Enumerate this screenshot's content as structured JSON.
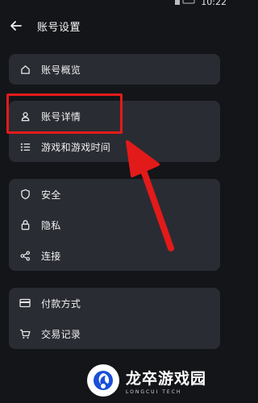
{
  "status_bar": {
    "time": "10:22"
  },
  "header": {
    "title": "账号设置"
  },
  "groups": [
    {
      "items": [
        {
          "label": "账号概览",
          "icon": "home-icon"
        }
      ]
    },
    {
      "items": [
        {
          "label": "账号详情",
          "icon": "person-icon"
        },
        {
          "label": "游戏和游戏时间",
          "icon": "list-icon"
        }
      ]
    },
    {
      "items": [
        {
          "label": "安全",
          "icon": "shield-icon"
        },
        {
          "label": "隐私",
          "icon": "lock-icon"
        },
        {
          "label": "连接",
          "icon": "share-icon"
        }
      ]
    },
    {
      "items": [
        {
          "label": "付款方式",
          "icon": "credit-card-icon"
        },
        {
          "label": "交易记录",
          "icon": "cart-icon"
        }
      ]
    }
  ],
  "annotation": {
    "highlight_color": "#e31a1a"
  },
  "watermark": {
    "main": "龙卒游戏园",
    "sub": "LONGCUI TECH"
  }
}
